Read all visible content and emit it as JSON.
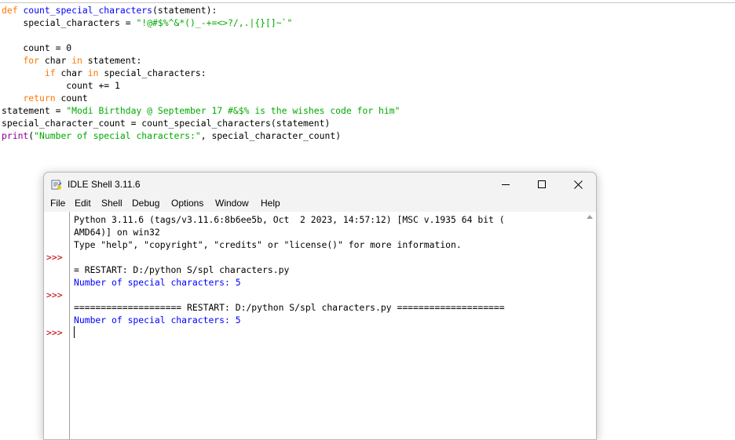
{
  "editor": {
    "lines": [
      {
        "parts": [
          {
            "t": "def ",
            "c": "kw"
          },
          {
            "t": "count_special_characters",
            "c": "fn"
          },
          {
            "t": "(statement):",
            "c": ""
          }
        ]
      },
      {
        "parts": [
          {
            "t": "    special_characters = ",
            "c": ""
          },
          {
            "t": "\"!@#$%^&*()_-+=<>?/,.|{}[]~`\"",
            "c": "st"
          }
        ]
      },
      {
        "parts": []
      },
      {
        "parts": [
          {
            "t": "    count = 0",
            "c": ""
          }
        ]
      },
      {
        "parts": [
          {
            "t": "    ",
            "c": ""
          },
          {
            "t": "for",
            "c": "kw"
          },
          {
            "t": " char ",
            "c": ""
          },
          {
            "t": "in",
            "c": "kw"
          },
          {
            "t": " statement:",
            "c": ""
          }
        ]
      },
      {
        "parts": [
          {
            "t": "        ",
            "c": ""
          },
          {
            "t": "if",
            "c": "kw"
          },
          {
            "t": " char ",
            "c": ""
          },
          {
            "t": "in",
            "c": "kw"
          },
          {
            "t": " special_characters:",
            "c": ""
          }
        ]
      },
      {
        "parts": [
          {
            "t": "            count += 1",
            "c": ""
          }
        ]
      },
      {
        "parts": [
          {
            "t": "    ",
            "c": ""
          },
          {
            "t": "return",
            "c": "kw"
          },
          {
            "t": " count",
            "c": ""
          }
        ]
      },
      {
        "parts": [
          {
            "t": "statement = ",
            "c": ""
          },
          {
            "t": "\"Modi Birthday @ September 17 #&$% is the wishes code for him\"",
            "c": "st"
          }
        ]
      },
      {
        "parts": [
          {
            "t": "special_character_count = count_special_characters(statement)",
            "c": ""
          }
        ]
      },
      {
        "parts": [
          {
            "t": "print",
            "c": "bi"
          },
          {
            "t": "(",
            "c": ""
          },
          {
            "t": "\"Number of special characters:\"",
            "c": "st"
          },
          {
            "t": ", special_character_count)",
            "c": ""
          }
        ]
      }
    ]
  },
  "window": {
    "title": "IDLE Shell 3.11.6",
    "controls": {
      "minimize": "minimize-icon",
      "maximize": "maximize-icon",
      "close": "close-icon"
    }
  },
  "menu": [
    "File",
    "Edit",
    "Shell",
    "Debug",
    "Options",
    "Window",
    "Help"
  ],
  "shell": {
    "prompt": ">>>",
    "banner_1": "Python 3.11.6 (tags/v3.11.6:8b6ee5b, Oct  2 2023, 14:57:12) [MSC v.1935 64 bit (",
    "banner_2": "AMD64)] on win32",
    "banner_3": "Type \"help\", \"copyright\", \"credits\" or \"license()\" for more information.",
    "restart_1": "= RESTART: D:/python S/spl characters.py",
    "output_1": "Number of special characters: 5",
    "restart_2": "==================== RESTART: D:/python S/spl characters.py ====================",
    "output_2": "Number of special characters: 5"
  },
  "colors": {
    "keyword": "#ff7700",
    "function": "#0000ff",
    "string": "#00aa00",
    "builtin": "#900090",
    "prompt": "#c00000",
    "output": "#0000ff"
  }
}
